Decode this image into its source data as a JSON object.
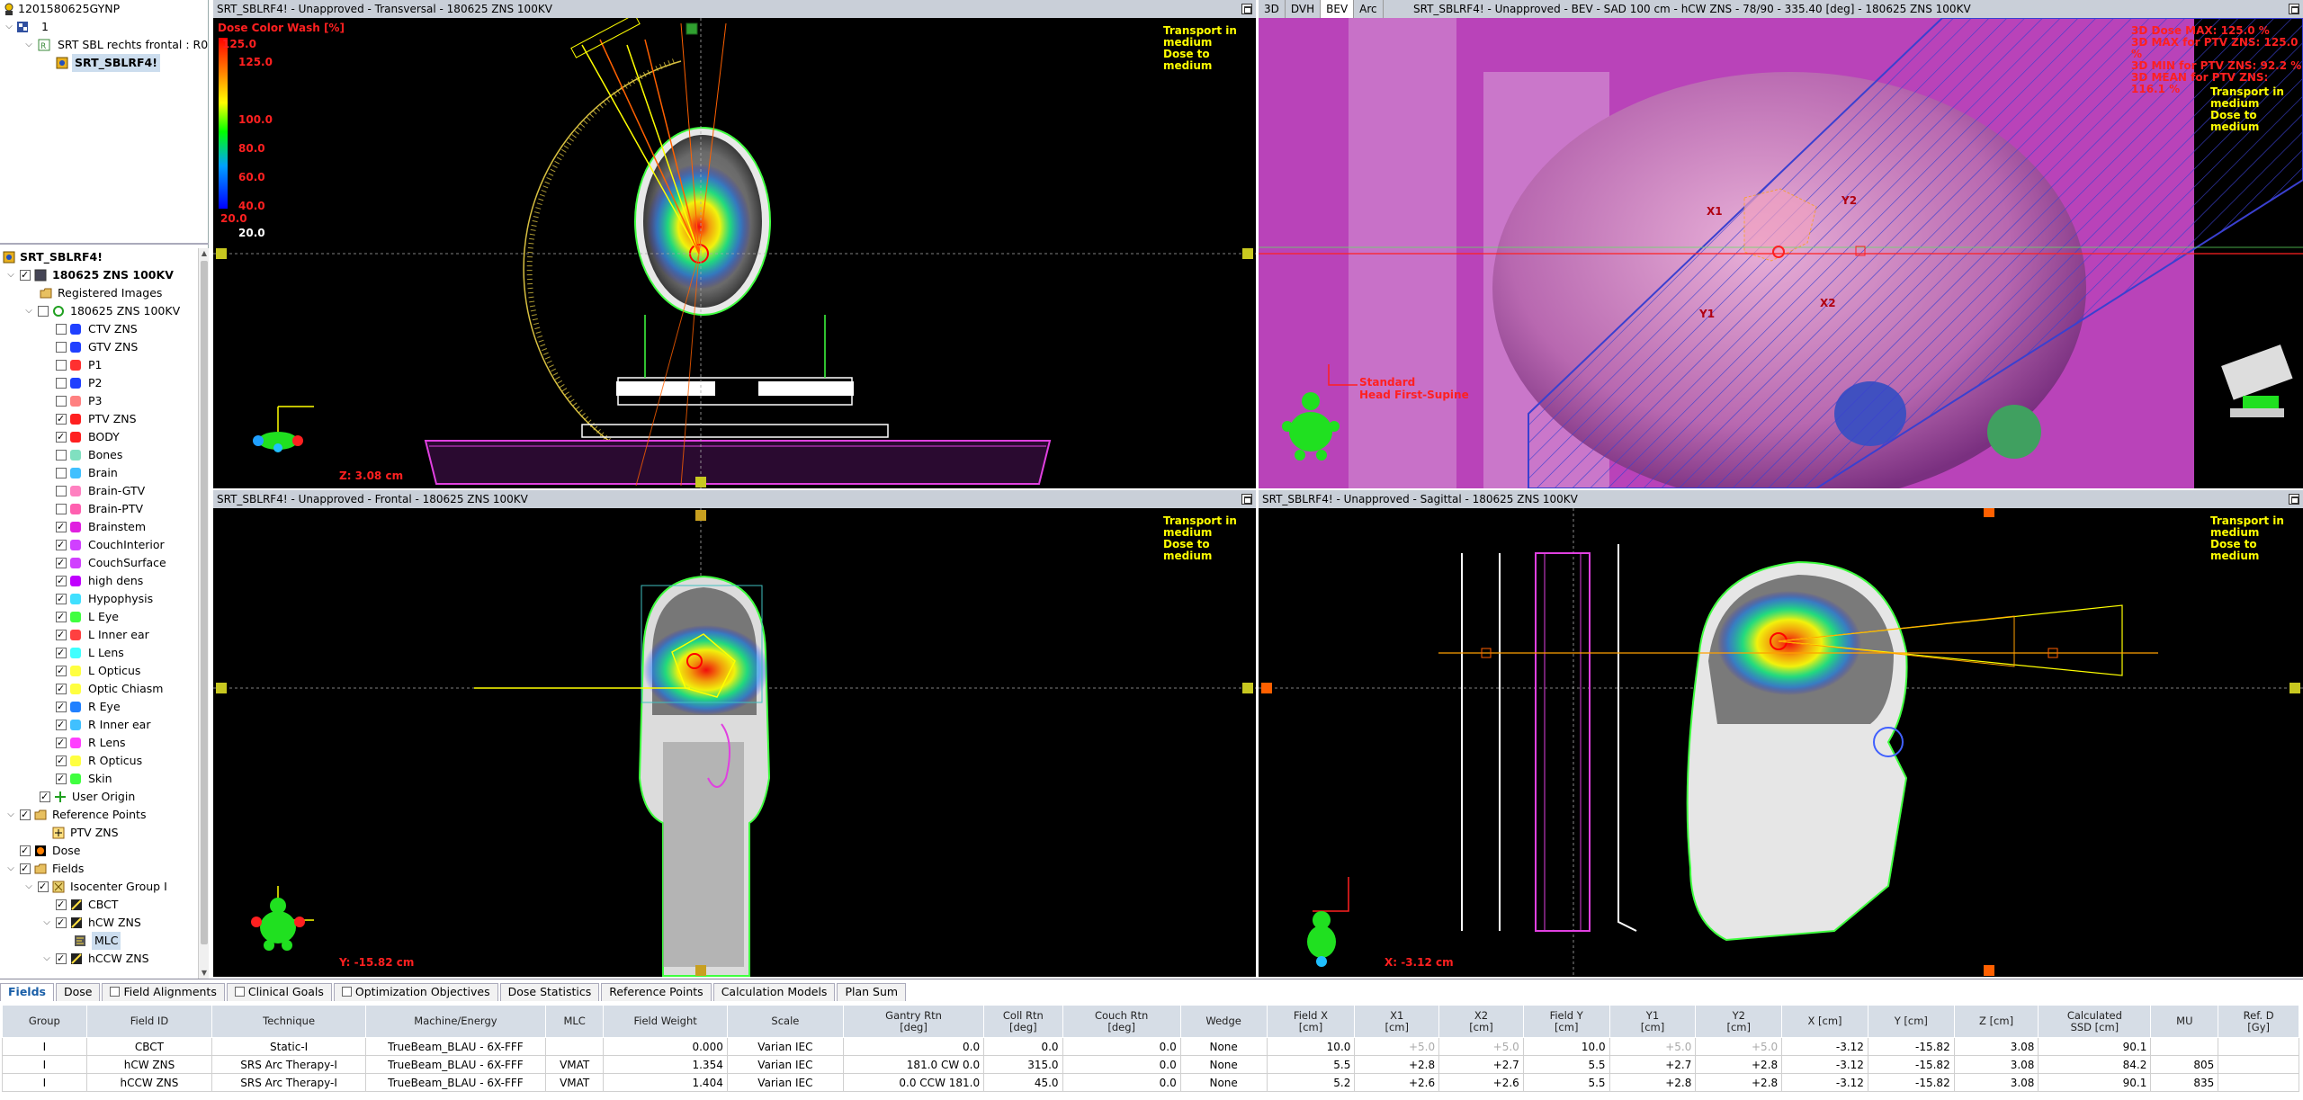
{
  "plan_tree": {
    "patient_id": "1201580625GYNP",
    "course": "1",
    "plan_group": "SRT SBL rechts frontal : R0",
    "plan": "SRT_SBLRF4!"
  },
  "structure_tree": {
    "plan": "SRT_SBLRF4!",
    "image": "180625 ZNS 100KV",
    "registered_images": "Registered Images",
    "structure_set": "180625 ZNS 100KV",
    "structures": [
      {
        "name": "CTV ZNS",
        "color": "#2040ff",
        "checked": false
      },
      {
        "name": "GTV ZNS",
        "color": "#2040ff",
        "checked": false
      },
      {
        "name": "P1",
        "color": "#ff3030",
        "checked": false
      },
      {
        "name": "P2",
        "color": "#2040ff",
        "checked": false
      },
      {
        "name": "P3",
        "color": "#ff8080",
        "checked": false
      },
      {
        "name": "PTV ZNS",
        "color": "#ff2020",
        "checked": true
      },
      {
        "name": "BODY",
        "color": "#ff2020",
        "checked": true
      },
      {
        "name": "Bones",
        "color": "#80e0c0",
        "checked": false
      },
      {
        "name": "Brain",
        "color": "#40c0ff",
        "checked": false
      },
      {
        "name": "Brain-GTV",
        "color": "#ff80c0",
        "checked": false
      },
      {
        "name": "Brain-PTV",
        "color": "#ff60b0",
        "checked": false
      },
      {
        "name": "Brainstem",
        "color": "#e020e0",
        "checked": true
      },
      {
        "name": "CouchInterior",
        "color": "#d040ff",
        "checked": true
      },
      {
        "name": "CouchSurface",
        "color": "#d040ff",
        "checked": true
      },
      {
        "name": "high dens",
        "color": "#c000ff",
        "checked": true
      },
      {
        "name": "Hypophysis",
        "color": "#40e0ff",
        "checked": true
      },
      {
        "name": "L Eye",
        "color": "#40ff40",
        "checked": true
      },
      {
        "name": "L Inner ear",
        "color": "#ff4040",
        "checked": true
      },
      {
        "name": "L Lens",
        "color": "#40ffff",
        "checked": true
      },
      {
        "name": "L Opticus",
        "color": "#ffff40",
        "checked": true
      },
      {
        "name": "Optic Chiasm",
        "color": "#ffff40",
        "checked": true
      },
      {
        "name": "R Eye",
        "color": "#2080ff",
        "checked": true
      },
      {
        "name": "R Inner ear",
        "color": "#40c0ff",
        "checked": true
      },
      {
        "name": "R Lens",
        "color": "#ff40ff",
        "checked": true
      },
      {
        "name": "R Opticus",
        "color": "#ffff40",
        "checked": true
      },
      {
        "name": "Skin",
        "color": "#40ff40",
        "checked": true
      }
    ],
    "user_origin": "User Origin",
    "reference_points": "Reference Points",
    "ref_point": "PTV ZNS",
    "dose": "Dose",
    "fields": "Fields",
    "isocenter_group": "Isocenter Group I",
    "field_items": [
      "CBCT",
      "hCW ZNS",
      "MLC",
      "hCCW ZNS"
    ]
  },
  "viewports": {
    "transversal": {
      "title": "SRT_SBLRF4!  -  Unapproved - Transversal - 180625 ZNS 100KV",
      "colorwash_title": "Dose Color Wash [%]",
      "colorwash_max": "125.0",
      "colorwash_ticks": [
        "125.0",
        "100.0",
        "80.0",
        "60.0",
        "40.0",
        "20.0"
      ],
      "colorwash_min": "20.0",
      "transport": "Transport in medium",
      "dose_to": "Dose to medium",
      "coord": "Z: 3.08 cm"
    },
    "bev": {
      "tabs": [
        "3D",
        "DVH",
        "BEV",
        "Arc"
      ],
      "active_tab": "BEV",
      "title": "SRT_SBLRF4!  -  Unapproved - BEV - SAD 100 cm - hCW ZNS - 78/90 - 335.40 [deg] - 180625 ZNS 100KV",
      "dose_stats": [
        "3D Dose MAX: 125.0 %",
        "3D MAX for PTV ZNS: 125.0 %",
        "3D MIN for PTV ZNS: 92.2 %",
        "3D MEAN for PTV ZNS: 116.1 %"
      ],
      "transport": "Transport in medium",
      "dose_to": "Dose to medium",
      "orientation": "Standard",
      "position": "Head First-Supine",
      "jaw_labels": [
        "X1",
        "Y2",
        "Y1",
        "X2"
      ]
    },
    "frontal": {
      "title": "SRT_SBLRF4!  -  Unapproved - Frontal - 180625 ZNS 100KV",
      "transport": "Transport in medium",
      "dose_to": "Dose to medium",
      "coord": "Y: -15.82 cm"
    },
    "sagittal": {
      "title": "SRT_SBLRF4!  -  Unapproved - Sagittal - 180625 ZNS 100KV",
      "transport": "Transport in medium",
      "dose_to": "Dose to medium",
      "coord": "X: -3.12 cm"
    }
  },
  "bottom_tabs": [
    {
      "label": "Fields",
      "active": true,
      "checkbox": false
    },
    {
      "label": "Dose",
      "active": false,
      "checkbox": false
    },
    {
      "label": "Field Alignments",
      "active": false,
      "checkbox": true
    },
    {
      "label": "Clinical Goals",
      "active": false,
      "checkbox": true
    },
    {
      "label": "Optimization Objectives",
      "active": false,
      "checkbox": true
    },
    {
      "label": "Dose Statistics",
      "active": false,
      "checkbox": false
    },
    {
      "label": "Reference Points",
      "active": false,
      "checkbox": false
    },
    {
      "label": "Calculation Models",
      "active": false,
      "checkbox": false
    },
    {
      "label": "Plan Sum",
      "active": false,
      "checkbox": false
    }
  ],
  "fields_table": {
    "headers": [
      "Group",
      "Field ID",
      "Technique",
      "Machine/Energy",
      "MLC",
      "Field Weight",
      "Scale",
      "Gantry Rtn\n[deg]",
      "Coll Rtn\n[deg]",
      "Couch Rtn\n[deg]",
      "Wedge",
      "Field X\n[cm]",
      "X1\n[cm]",
      "X2\n[cm]",
      "Field Y\n[cm]",
      "Y1\n[cm]",
      "Y2\n[cm]",
      "X [cm]",
      "Y [cm]",
      "Z [cm]",
      "Calculated\nSSD [cm]",
      "MU",
      "Ref. D\n[Gy]"
    ],
    "rows": [
      [
        "I",
        "CBCT",
        "Static-I",
        "TrueBeam_BLAU - 6X-FFF",
        "",
        "0.000",
        "Varian IEC",
        "0.0",
        "0.0",
        "0.0",
        "None",
        "10.0",
        "+5.0",
        "+5.0",
        "10.0",
        "+5.0",
        "+5.0",
        "-3.12",
        "-15.82",
        "3.08",
        "90.1",
        "",
        ""
      ],
      [
        "I",
        "hCW ZNS",
        "SRS Arc Therapy-I",
        "TrueBeam_BLAU - 6X-FFF",
        "VMAT",
        "1.354",
        "Varian IEC",
        "181.0 CW 0.0",
        "315.0",
        "0.0",
        "None",
        "5.5",
        "+2.8",
        "+2.7",
        "5.5",
        "+2.7",
        "+2.8",
        "-3.12",
        "-15.82",
        "3.08",
        "84.2",
        "805",
        ""
      ],
      [
        "I",
        "hCCW ZNS",
        "SRS Arc Therapy-I",
        "TrueBeam_BLAU - 6X-FFF",
        "VMAT",
        "1.404",
        "Varian IEC",
        "0.0 CCW 181.0",
        "45.0",
        "0.0",
        "None",
        "5.2",
        "+2.6",
        "+2.6",
        "5.5",
        "+2.8",
        "+2.8",
        "-3.12",
        "-15.82",
        "3.08",
        "90.1",
        "835",
        ""
      ]
    ]
  }
}
